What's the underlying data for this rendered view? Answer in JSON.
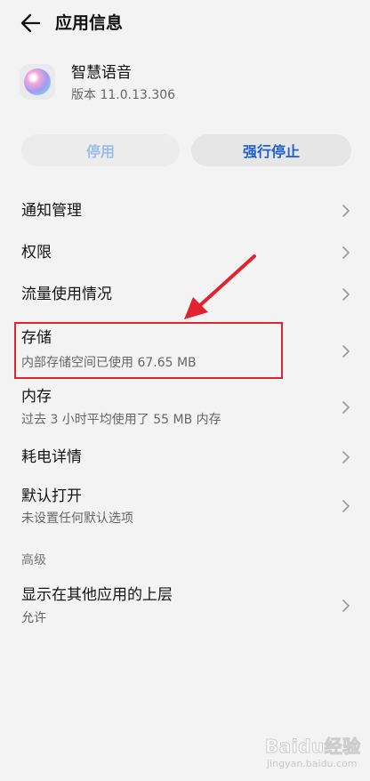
{
  "header": {
    "title": "应用信息",
    "back_icon": "arrow-left-icon"
  },
  "app": {
    "name": "智慧语音",
    "version": "版本 11.0.13.306",
    "icon": "voice-assistant-orb-icon"
  },
  "actions": {
    "disable_label": "停用",
    "force_stop_label": "强行停止"
  },
  "items": [
    {
      "title": "通知管理"
    },
    {
      "title": "权限"
    },
    {
      "title": "流量使用情况"
    },
    {
      "title": "存储",
      "subtitle": "内部存储空间已使用 67.65 MB"
    },
    {
      "title": "内存",
      "subtitle": "过去 3 小时平均使用了 55 MB 内存"
    },
    {
      "title": "耗电详情"
    },
    {
      "title": "默认打开",
      "subtitle": "未设置任何默认选项"
    }
  ],
  "advanced": {
    "section_label": "高级",
    "items": [
      {
        "title": "显示在其他应用的上层",
        "subtitle": "允许"
      }
    ]
  },
  "watermark": {
    "main": "Baidu经验",
    "sub": "jingyan.baidu.com"
  },
  "colors": {
    "accent": "#1f5fcf",
    "disabled_accent": "#9cbde8",
    "annotation_red": "#e1232f",
    "background": "#f3f3f3"
  }
}
